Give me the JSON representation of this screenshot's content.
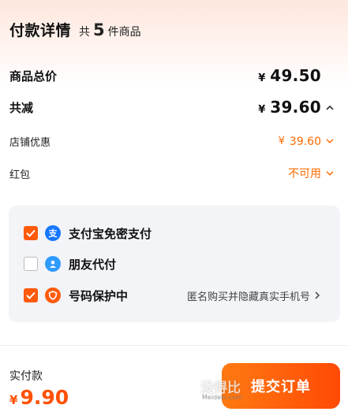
{
  "header": {
    "title": "付款详情",
    "count_prefix": "共",
    "count": "5",
    "count_suffix": "件商品"
  },
  "rows": {
    "total": {
      "label": "商品总价",
      "currency": "¥",
      "value": "49.50"
    },
    "discount": {
      "label": "共减",
      "currency": "¥",
      "value": "39.60"
    },
    "shop": {
      "label": "店铺优惠",
      "currency": "¥",
      "value": "39.60"
    },
    "redpacket": {
      "label": "红包",
      "value": "不可用"
    }
  },
  "options": [
    {
      "label": "支付宝免密支付",
      "checked": true,
      "icon": "alipay-icon",
      "icon_color": "#1677ff"
    },
    {
      "label": "朋友代付",
      "checked": false,
      "icon": "friend-icon",
      "icon_color": "#2f9bff"
    },
    {
      "label": "号码保护中",
      "checked": true,
      "icon": "shield-icon",
      "icon_color": "#ff5a0a",
      "hint": "匿名购买并隐藏真实手机号"
    }
  ],
  "footer": {
    "pay_label": "实付款",
    "currency": "¥",
    "pay_value": "9.90",
    "submit_label": "提交订单"
  },
  "watermark": {
    "text": "没得比",
    "sub": "Meidebi.com"
  },
  "colors": {
    "accent": "#ff5a0a",
    "price_orange": "#ff6a00",
    "panel_bg": "#f2f4f7"
  }
}
